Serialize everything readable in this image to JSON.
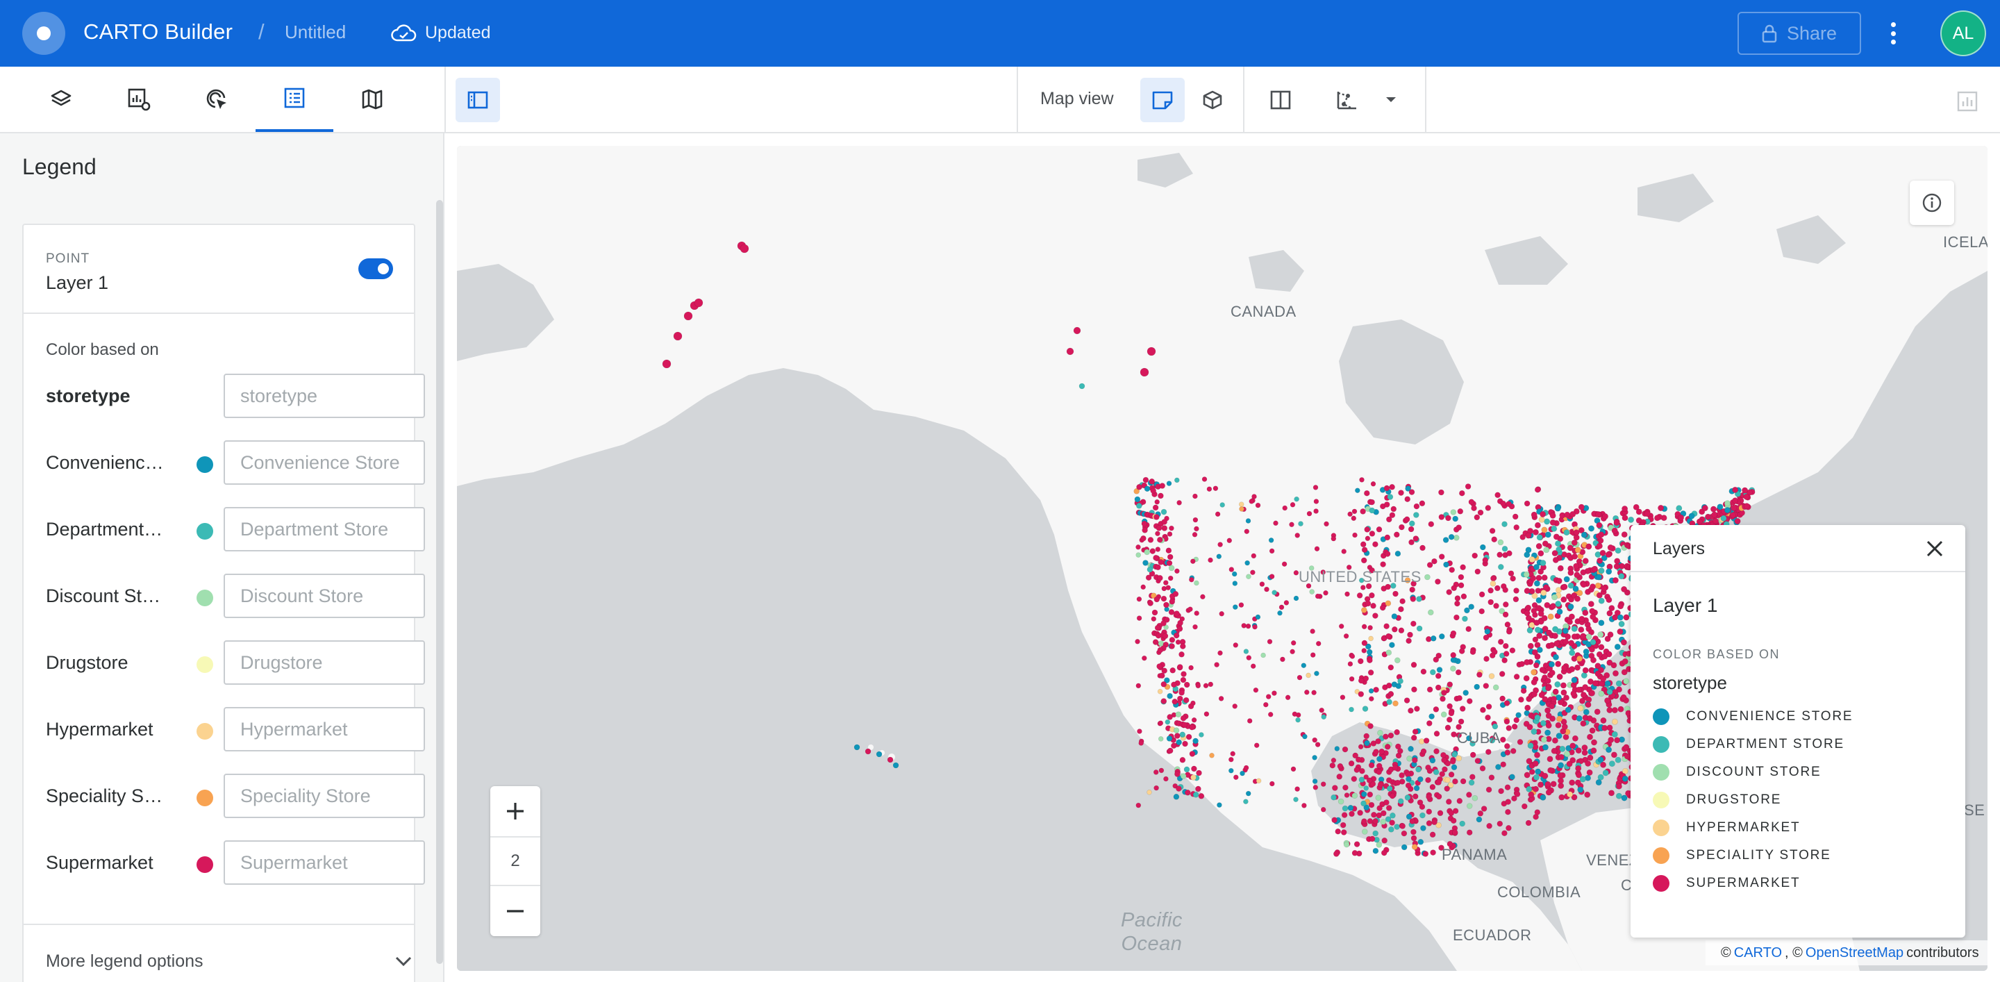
{
  "appbar": {
    "title": "CARTO Builder",
    "separator": "/",
    "map_name": "Untitled",
    "save_status": "Updated",
    "share_label": "Share",
    "avatar_initials": "AL"
  },
  "toolbar": {
    "tabs": [
      "layers-icon",
      "widgets-settings-icon",
      "interactions-icon",
      "legend-icon",
      "basemap-icon"
    ],
    "active_tab": "legend-icon",
    "map_view_label": "Map view"
  },
  "legend_panel": {
    "title": "Legend",
    "layer": {
      "type": "POINT",
      "name": "Layer 1",
      "visible": true
    },
    "color_based_on_label": "Color based on",
    "field": {
      "label": "storetype",
      "placeholder": "storetype"
    },
    "categories": [
      {
        "label": "Convenience Store",
        "placeholder": "Convenience Store",
        "color": "#0f95b9"
      },
      {
        "label": "Department Store",
        "placeholder": "Department Store",
        "color": "#3cbab5"
      },
      {
        "label": "Discount Store",
        "placeholder": "Discount Store",
        "color": "#a0dfaf"
      },
      {
        "label": "Drugstore",
        "placeholder": "Drugstore",
        "color": "#f7f9b6"
      },
      {
        "label": "Hypermarket",
        "placeholder": "Hypermarket",
        "color": "#fbd390"
      },
      {
        "label": "Speciality Store",
        "placeholder": "Speciality Store",
        "color": "#f8a352"
      },
      {
        "label": "Supermarket",
        "placeholder": "Supermarket",
        "color": "#d6185b"
      }
    ],
    "more_options_label": "More legend options"
  },
  "map": {
    "zoom_level": "2",
    "labels": {
      "canada": "CANADA",
      "usa": "UNITED STATES",
      "cuba": "CUBA",
      "panama": "PANAMA",
      "venezuela": "VENEZUE",
      "colombia": "COLOMBIA",
      "ecuador": "ECUADOR",
      "iceland": "ICELAN",
      "pacific_1": "Pacific",
      "pacific_2": "Ocean",
      "right_edge": "SE",
      "right_edge_2": "C"
    },
    "attribution": {
      "copy1": "©",
      "carto": "CARTO",
      "copy2": ", ©",
      "osm": "OpenStreetMap",
      "contrib": "contributors"
    }
  },
  "layers_popover": {
    "title": "Layers",
    "layer_name": "Layer 1",
    "color_based_on_label": "COLOR BASED ON",
    "field": "storetype",
    "items": [
      {
        "label": "CONVENIENCE STORE",
        "color": "#0f95b9"
      },
      {
        "label": "DEPARTMENT STORE",
        "color": "#3cbab5"
      },
      {
        "label": "DISCOUNT STORE",
        "color": "#a0dfaf"
      },
      {
        "label": "DRUGSTORE",
        "color": "#f7f9b6"
      },
      {
        "label": "HYPERMARKET",
        "color": "#fbd390"
      },
      {
        "label": "SPECIALITY STORE",
        "color": "#f8a352"
      },
      {
        "label": "SUPERMARKET",
        "color": "#d6185b"
      }
    ]
  },
  "colors": {
    "brand": "#1068d9",
    "avatar": "#13b286",
    "map_water": "#d3d6d9",
    "map_land": "#f7f7f7"
  }
}
